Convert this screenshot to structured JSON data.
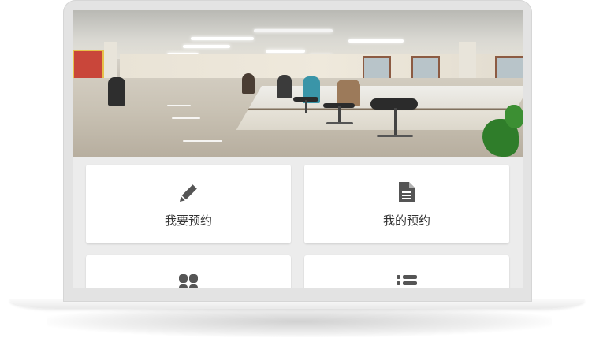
{
  "menu": {
    "tiles": [
      {
        "label": "我要预约",
        "icon": "pencil-icon"
      },
      {
        "label": "我的预约",
        "icon": "document-icon"
      },
      {
        "label": "",
        "icon": "grid-icon"
      },
      {
        "label": "",
        "icon": "list-icon"
      }
    ]
  },
  "colors": {
    "icon": "#555555",
    "tile_bg": "#ffffff",
    "screen_bg": "#ececec",
    "bezel": "#e3e3e3"
  }
}
